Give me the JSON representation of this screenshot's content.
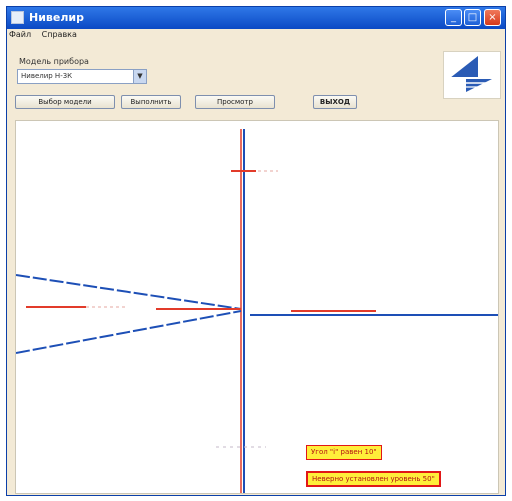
{
  "window": {
    "title": "Нивелир"
  },
  "menubar": {
    "items": [
      "Файл",
      "Справка"
    ]
  },
  "model": {
    "label": "Модель прибора",
    "selected": "Нивелир Н-3К"
  },
  "toolbar": {
    "buttons": [
      "Выбор модели",
      "Выполнить",
      "Просмотр",
      "ВЫХОД"
    ]
  },
  "status": {
    "line1": "Угол \"i\" равен 10\"",
    "line2": "Неверно установлен уровень 50\""
  },
  "icons": {
    "logo": "level-instrument-logo"
  },
  "colors": {
    "title_bar": "#0b49c4",
    "axis_blue": "#1d4fb6",
    "axis_red": "#e23b2a",
    "status_bg": "#ffee3a",
    "status_border": "#e11717"
  }
}
